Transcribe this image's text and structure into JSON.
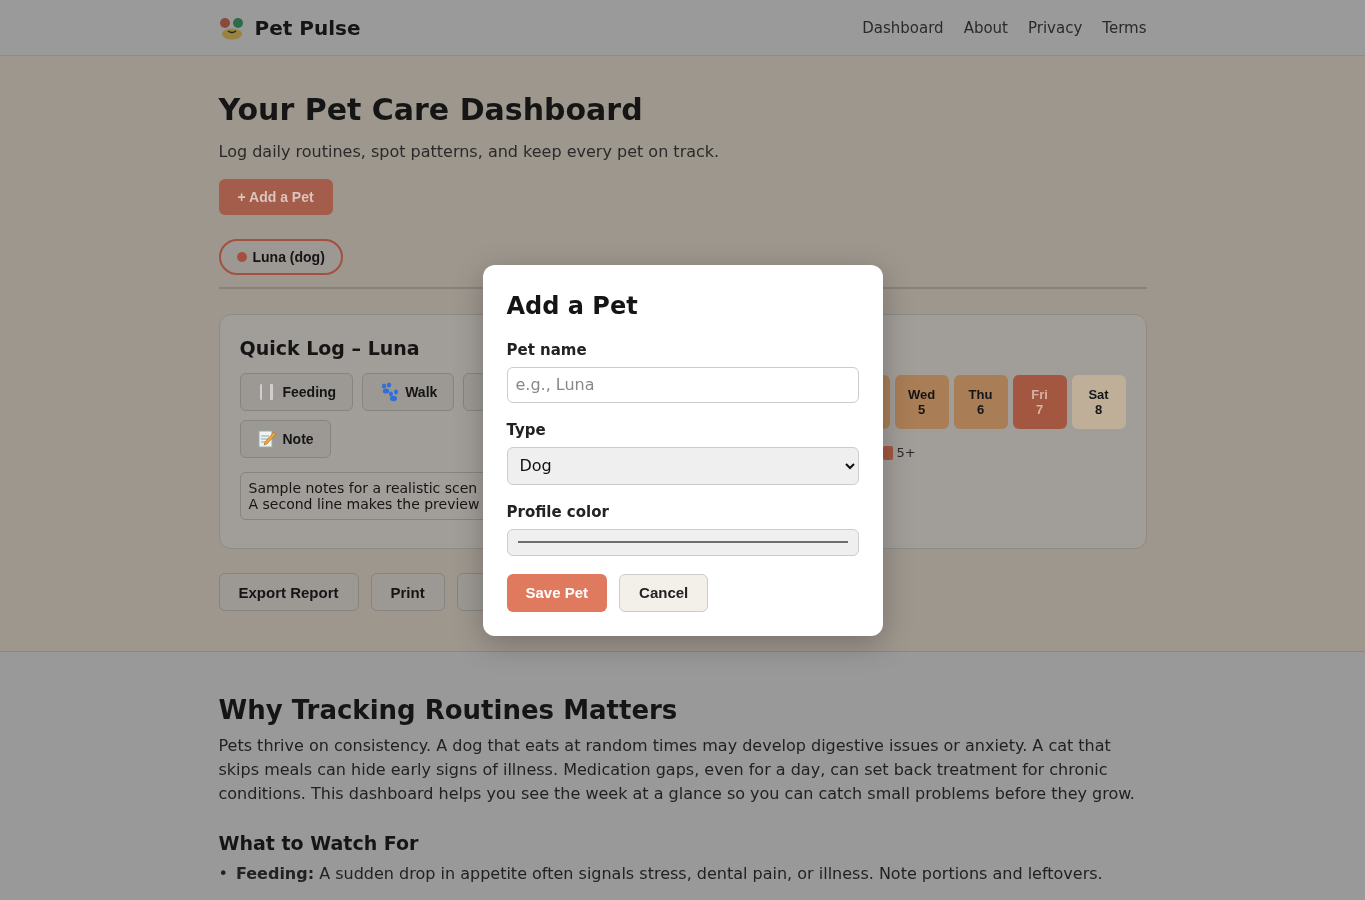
{
  "header": {
    "brand": "Pet Pulse",
    "nav": [
      {
        "label": "Dashboard"
      },
      {
        "label": "About"
      },
      {
        "label": "Privacy"
      },
      {
        "label": "Terms"
      }
    ]
  },
  "hero": {
    "title": "Your Pet Care Dashboard",
    "subtitle": "Log daily routines, spot patterns, and keep every pet on track.",
    "add_button": "+ Add a Pet",
    "pets": [
      {
        "label": "Luna (dog)",
        "color": "#a3503f",
        "selected": true
      }
    ]
  },
  "quick_log": {
    "title": "Quick Log – Luna",
    "buttons": [
      {
        "kind": "feeding",
        "label": "Feeding"
      },
      {
        "kind": "walk",
        "label": "Walk"
      },
      {
        "kind": "hidden"
      },
      {
        "kind": "note",
        "label": "Note"
      }
    ],
    "notes": [
      "Sample notes for a realistic scen",
      "A second line makes the preview"
    ]
  },
  "week": {
    "cells": [
      {
        "kind": "hidden",
        "color": "#a97d55"
      },
      {
        "day": "Wed",
        "date": "5",
        "color": "#a97d55"
      },
      {
        "day": "Thu",
        "date": "6",
        "color": "#a97d55"
      },
      {
        "day": "Fri",
        "date": "7",
        "color": "#a35741"
      },
      {
        "day": "Sat",
        "date": "8",
        "color": "#bfae98"
      }
    ],
    "legend": [
      {
        "label": "5+",
        "color": "#a35741"
      }
    ]
  },
  "actions": [
    {
      "kind": "button",
      "label": "Export Report"
    },
    {
      "kind": "button",
      "label": "Print"
    },
    {
      "kind": "hidden"
    }
  ],
  "info": {
    "title": "Why Tracking Routines Matters",
    "paragraph": "Pets thrive on consistency. A dog that eats at random times may develop digestive issues or anxiety. A cat that skips meals can hide early signs of illness. Medication gaps, even for a day, can set back treatment for chronic conditions. This dashboard helps you see the week at a glance so you can catch small problems before they grow.",
    "subtitle": "What to Watch For",
    "items": [
      {
        "marker": "•",
        "text": "**Feeding:** A sudden drop in appetite often signals stress, dental pain, or illness. Note portions and leftovers."
      }
    ]
  },
  "modal": {
    "title": "Add a Pet",
    "fields": [
      {
        "kind": "text",
        "label": "Pet name",
        "placeholder": "e.g., Luna"
      },
      {
        "kind": "select",
        "label": "Type",
        "value": "Dog"
      },
      {
        "kind": "color",
        "label": "Profile color",
        "color": "#6e6e6e"
      }
    ],
    "buttons": [
      {
        "kind": "primary",
        "label": "Save Pet"
      },
      {
        "kind": "secondary",
        "label": "Cancel"
      }
    ]
  }
}
